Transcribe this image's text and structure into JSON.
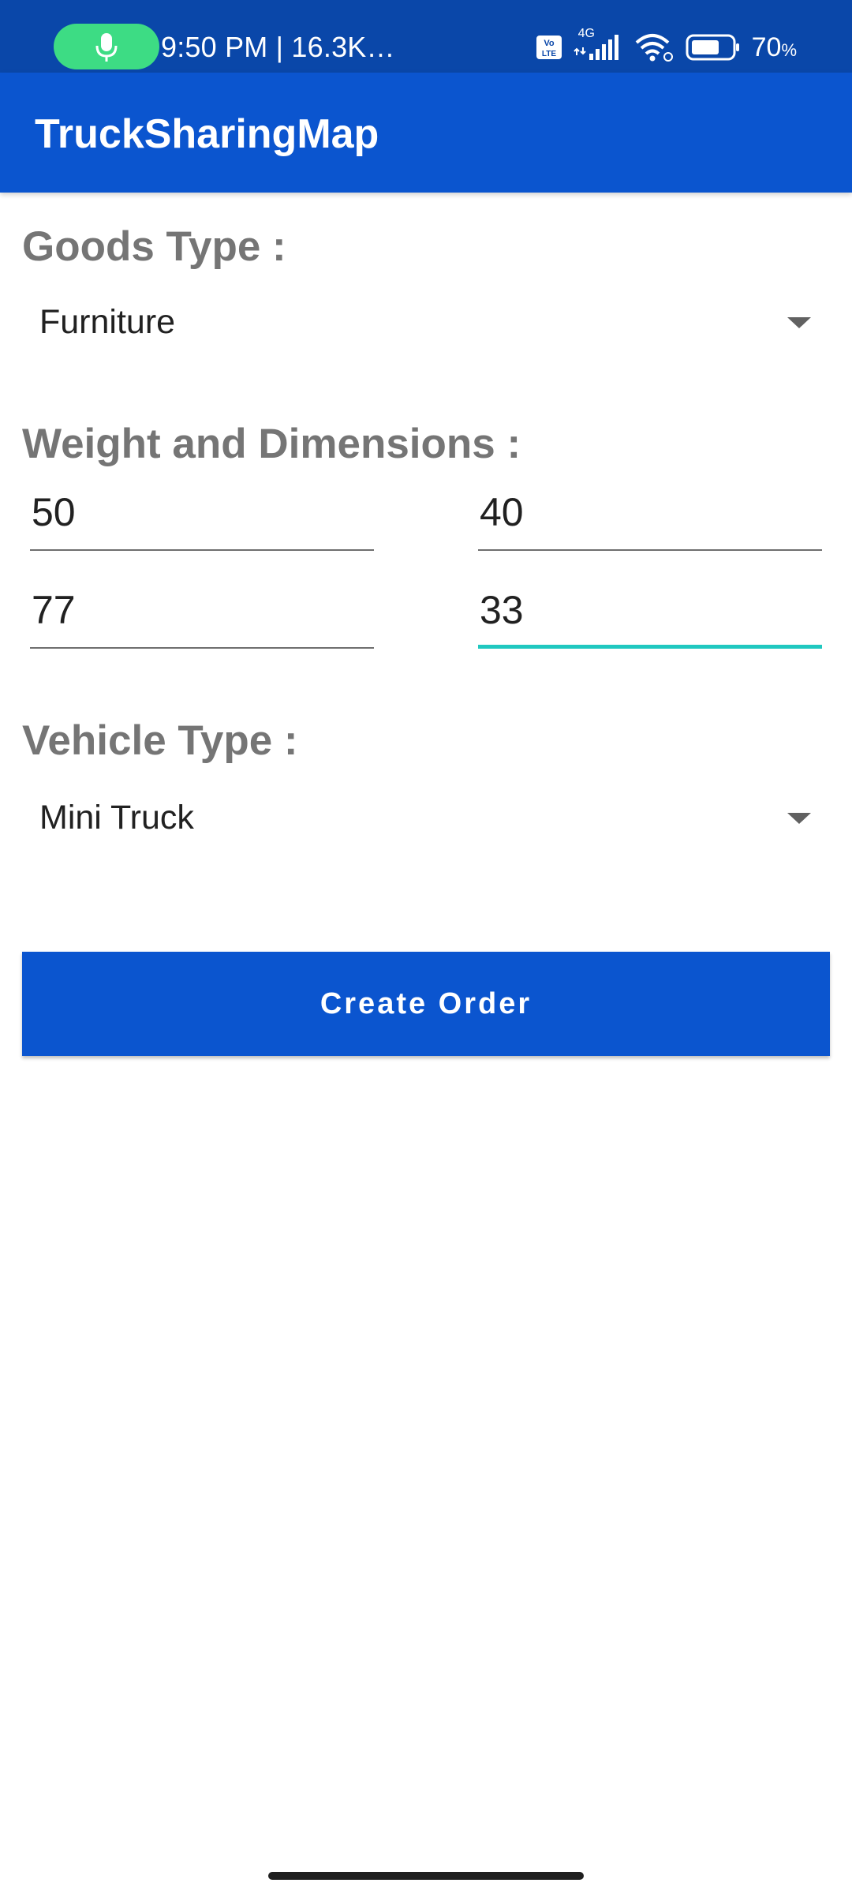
{
  "status_bar": {
    "time_text": "9:50 PM | 16.3K…",
    "network_badge": "4G",
    "battery": "70",
    "battery_unit": "%",
    "icons": [
      "mic-icon",
      "volte-icon",
      "signal-icon",
      "wifi-icon",
      "battery-icon"
    ],
    "colors": {
      "background": "#0a47a9",
      "mic_pill": "#3ddc84"
    }
  },
  "app_bar": {
    "title": "TruckSharingMap",
    "color": "#0b55cf"
  },
  "goods_type": {
    "label": "Goods Type :",
    "selected": "Furniture",
    "icon": "dropdown-arrow-icon"
  },
  "weight_dimensions": {
    "label": "Weight and Dimensions :",
    "fields": [
      {
        "value": "50"
      },
      {
        "value": "40"
      },
      {
        "value": "77"
      },
      {
        "value": "33",
        "focused": true
      }
    ],
    "focus_color": "#20c8c0"
  },
  "vehicle_type": {
    "label": "Vehicle Type :",
    "selected": "Mini Truck",
    "icon": "dropdown-arrow-icon"
  },
  "create_button": {
    "label": "Create Order"
  }
}
